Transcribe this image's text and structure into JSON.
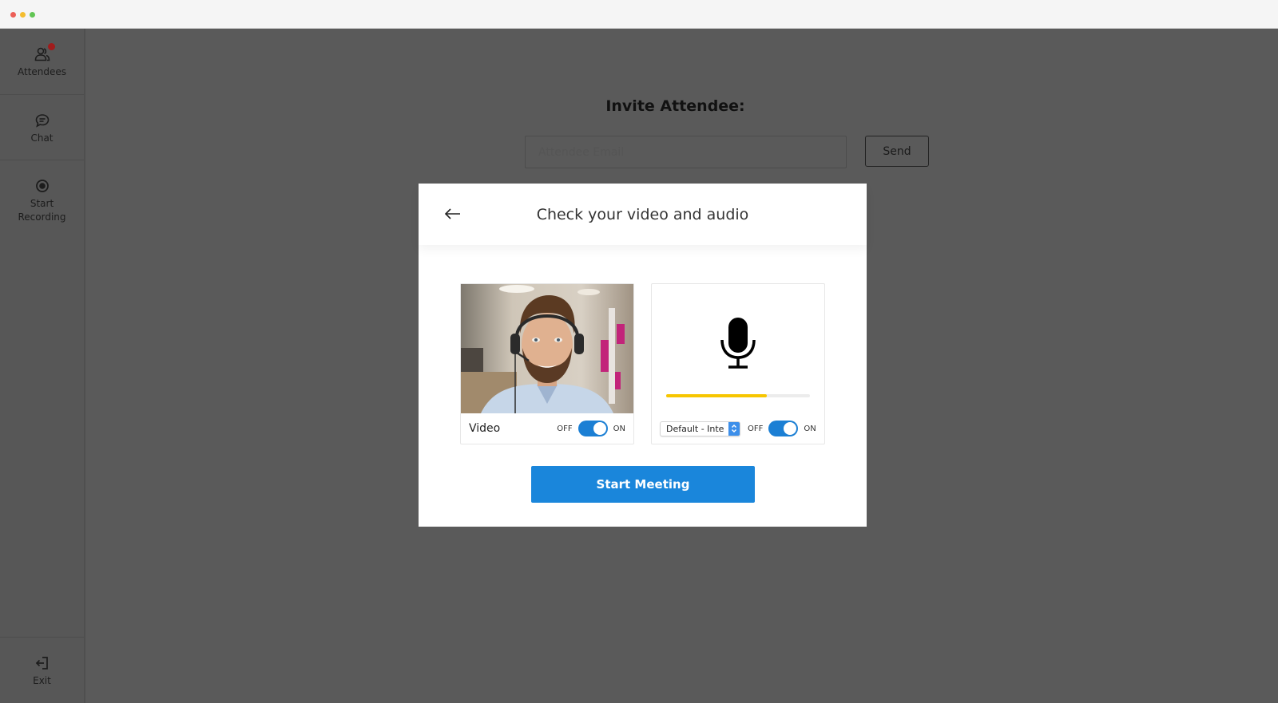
{
  "window": {
    "traffic_lights": [
      "close",
      "minimize",
      "maximize"
    ]
  },
  "sidebar": {
    "items": [
      {
        "label": "Attendees",
        "icon": "users-icon",
        "has_notification": true
      },
      {
        "label": "Chat",
        "icon": "chat-bubble-icon"
      },
      {
        "label": "Start\nRecording",
        "label_line1": "Start",
        "label_line2": "Recording",
        "icon": "record-icon"
      }
    ],
    "exit": {
      "label": "Exit",
      "icon": "exit-icon"
    }
  },
  "invite": {
    "title": "Invite Attendee:",
    "email_placeholder": "Attendee Email",
    "email_value": "",
    "send_label": "Send"
  },
  "modal": {
    "title": "Check your video and audio",
    "back_icon": "arrow-left-icon",
    "video": {
      "label": "Video",
      "toggle_off_label": "OFF",
      "toggle_on_label": "ON",
      "enabled": true
    },
    "audio": {
      "device_selected": "Default - Inte",
      "toggle_off_label": "OFF",
      "toggle_on_label": "ON",
      "enabled": true,
      "input_level": 0.7,
      "mic_icon": "microphone-icon"
    },
    "start_label": "Start Meeting"
  },
  "colors": {
    "accent": "#1a86db",
    "toggle": "#1b7fd4",
    "level": "#f7c600",
    "overlay": "#5a5a5a",
    "badge": "#a01c1c"
  }
}
